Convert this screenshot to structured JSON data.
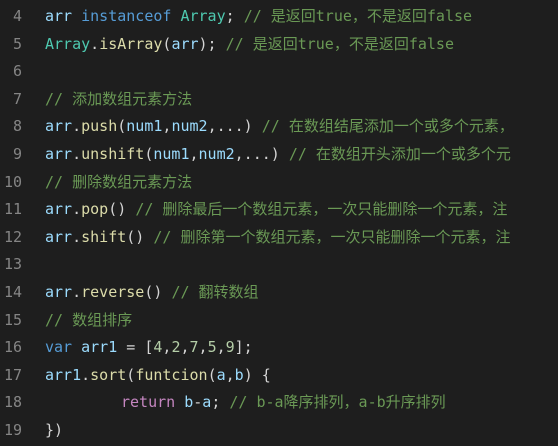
{
  "editor": {
    "background": "#1e1e1e",
    "colors": {
      "plain": "#d4d4d4",
      "variable": "#9cdcfe",
      "keyword": "#569cd6",
      "control": "#c586c0",
      "function": "#dcdcaa",
      "type": "#4ec9b0",
      "number": "#b5cea8",
      "comment": "#6a9955",
      "line_number": "#858585"
    },
    "lines": [
      {
        "number": "4",
        "indent": 0,
        "tokens": [
          {
            "t": "arr",
            "k": "var"
          },
          {
            "t": " ",
            "k": "plain"
          },
          {
            "t": "instanceof",
            "k": "kw"
          },
          {
            "t": " ",
            "k": "plain"
          },
          {
            "t": "Array",
            "k": "type"
          },
          {
            "t": "; ",
            "k": "plain"
          },
          {
            "t": "// 是返回true，不是返回false",
            "k": "cmt"
          }
        ]
      },
      {
        "number": "5",
        "indent": 0,
        "tokens": [
          {
            "t": "Array",
            "k": "type"
          },
          {
            "t": ".",
            "k": "plain"
          },
          {
            "t": "isArray",
            "k": "fn"
          },
          {
            "t": "(",
            "k": "plain"
          },
          {
            "t": "arr",
            "k": "var"
          },
          {
            "t": "); ",
            "k": "plain"
          },
          {
            "t": "// 是返回true，不是返回false",
            "k": "cmt"
          }
        ]
      },
      {
        "number": "6",
        "indent": 0,
        "tokens": []
      },
      {
        "number": "7",
        "indent": 0,
        "tokens": [
          {
            "t": "// 添加数组元素方法",
            "k": "cmt"
          }
        ]
      },
      {
        "number": "8",
        "indent": 0,
        "tokens": [
          {
            "t": "arr",
            "k": "var"
          },
          {
            "t": ".",
            "k": "plain"
          },
          {
            "t": "push",
            "k": "fn"
          },
          {
            "t": "(",
            "k": "plain"
          },
          {
            "t": "num1",
            "k": "var"
          },
          {
            "t": ",",
            "k": "plain"
          },
          {
            "t": "num2",
            "k": "var"
          },
          {
            "t": ",...) ",
            "k": "plain"
          },
          {
            "t": "// 在数组结尾添加一个或多个元素，",
            "k": "cmt"
          }
        ]
      },
      {
        "number": "9",
        "indent": 0,
        "tokens": [
          {
            "t": "arr",
            "k": "var"
          },
          {
            "t": ".",
            "k": "plain"
          },
          {
            "t": "unshift",
            "k": "fn"
          },
          {
            "t": "(",
            "k": "plain"
          },
          {
            "t": "num1",
            "k": "var"
          },
          {
            "t": ",",
            "k": "plain"
          },
          {
            "t": "num2",
            "k": "var"
          },
          {
            "t": ",...) ",
            "k": "plain"
          },
          {
            "t": "// 在数组开头添加一个或多个元",
            "k": "cmt"
          }
        ]
      },
      {
        "number": "10",
        "indent": 0,
        "tokens": [
          {
            "t": "// 删除数组元素方法",
            "k": "cmt"
          }
        ]
      },
      {
        "number": "11",
        "indent": 0,
        "tokens": [
          {
            "t": "arr",
            "k": "var"
          },
          {
            "t": ".",
            "k": "plain"
          },
          {
            "t": "pop",
            "k": "fn"
          },
          {
            "t": "() ",
            "k": "plain"
          },
          {
            "t": "// 删除最后一个数组元素，一次只能删除一个元素，注",
            "k": "cmt"
          }
        ]
      },
      {
        "number": "12",
        "indent": 0,
        "tokens": [
          {
            "t": "arr",
            "k": "var"
          },
          {
            "t": ".",
            "k": "plain"
          },
          {
            "t": "shift",
            "k": "fn"
          },
          {
            "t": "() ",
            "k": "plain"
          },
          {
            "t": "// 删除第一个数组元素，一次只能删除一个元素，注",
            "k": "cmt"
          }
        ]
      },
      {
        "number": "13",
        "indent": 0,
        "tokens": []
      },
      {
        "number": "14",
        "indent": 0,
        "tokens": [
          {
            "t": "arr",
            "k": "var"
          },
          {
            "t": ".",
            "k": "plain"
          },
          {
            "t": "reverse",
            "k": "fn"
          },
          {
            "t": "() ",
            "k": "plain"
          },
          {
            "t": "// 翻转数组",
            "k": "cmt"
          }
        ]
      },
      {
        "number": "15",
        "indent": 0,
        "tokens": [
          {
            "t": "// 数组排序",
            "k": "cmt"
          }
        ]
      },
      {
        "number": "16",
        "indent": 0,
        "tokens": [
          {
            "t": "var",
            "k": "kw"
          },
          {
            "t": " ",
            "k": "plain"
          },
          {
            "t": "arr1",
            "k": "var"
          },
          {
            "t": " = [",
            "k": "plain"
          },
          {
            "t": "4",
            "k": "num"
          },
          {
            "t": ",",
            "k": "plain"
          },
          {
            "t": "2",
            "k": "num"
          },
          {
            "t": ",",
            "k": "plain"
          },
          {
            "t": "7",
            "k": "num"
          },
          {
            "t": ",",
            "k": "plain"
          },
          {
            "t": "5",
            "k": "num"
          },
          {
            "t": ",",
            "k": "plain"
          },
          {
            "t": "9",
            "k": "num"
          },
          {
            "t": "];",
            "k": "plain"
          }
        ]
      },
      {
        "number": "17",
        "indent": 0,
        "tokens": [
          {
            "t": "arr1",
            "k": "var"
          },
          {
            "t": ".",
            "k": "plain"
          },
          {
            "t": "sort",
            "k": "fn"
          },
          {
            "t": "(",
            "k": "plain"
          },
          {
            "t": "funtcion",
            "k": "fn"
          },
          {
            "t": "(",
            "k": "plain"
          },
          {
            "t": "a",
            "k": "var"
          },
          {
            "t": ",",
            "k": "plain"
          },
          {
            "t": "b",
            "k": "var"
          },
          {
            "t": ") {",
            "k": "plain"
          }
        ]
      },
      {
        "number": "18",
        "indent": 1,
        "tokens": [
          {
            "t": "return",
            "k": "ctrl"
          },
          {
            "t": " ",
            "k": "plain"
          },
          {
            "t": "b",
            "k": "var"
          },
          {
            "t": "-",
            "k": "plain"
          },
          {
            "t": "a",
            "k": "var"
          },
          {
            "t": "; ",
            "k": "plain"
          },
          {
            "t": "// b-a降序排列，a-b升序排列",
            "k": "cmt"
          }
        ]
      },
      {
        "number": "19",
        "indent": 0,
        "tokens": [
          {
            "t": "})",
            "k": "plain"
          }
        ]
      }
    ]
  }
}
